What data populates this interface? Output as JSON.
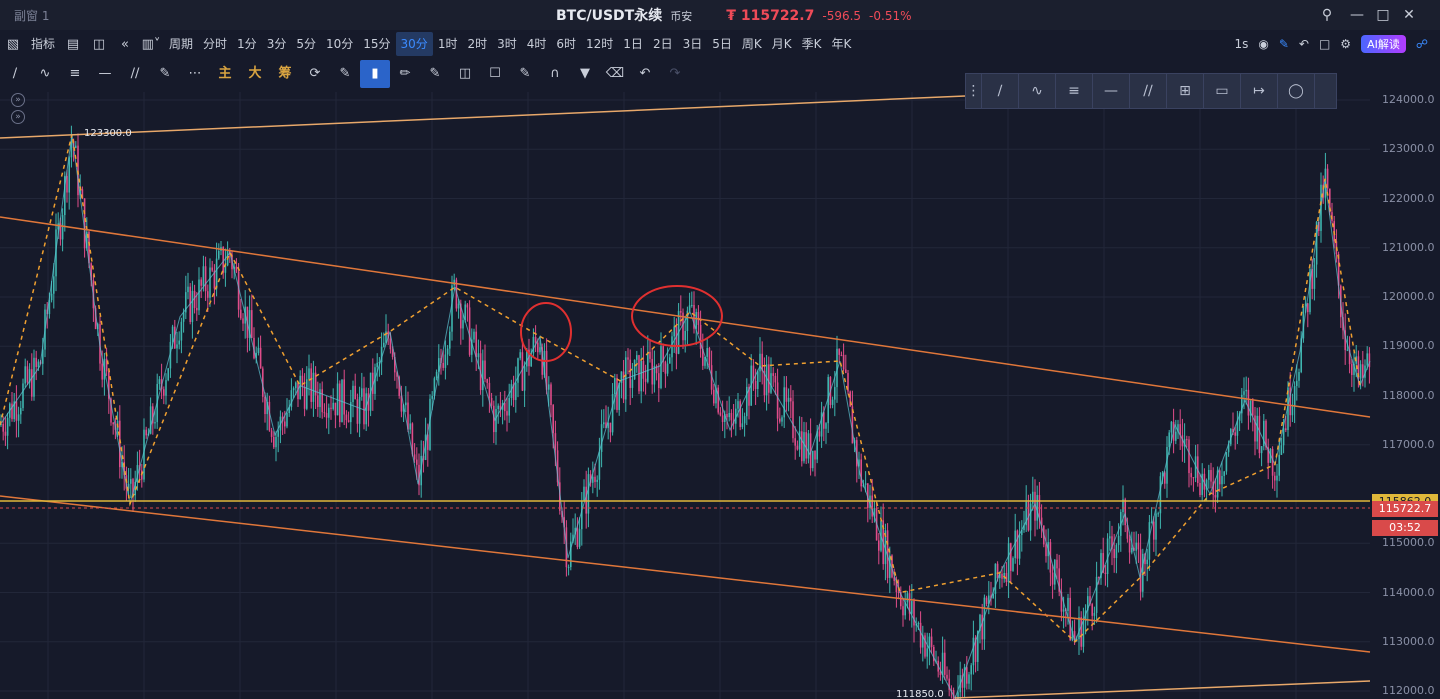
{
  "window": {
    "name": "副窗 1"
  },
  "header": {
    "symbol": "BTC/USDT永续",
    "exchange": "币安",
    "price": "₮ 115722.7",
    "change": "-596.5",
    "change_pct": "-0.51%"
  },
  "toolbar": {
    "indicator_label": "指标",
    "period_label": "周期",
    "intervals": [
      "分时",
      "1分",
      "3分",
      "5分",
      "10分",
      "15分",
      "30分",
      "1时",
      "2时",
      "3时",
      "4时",
      "6时",
      "12时",
      "1日",
      "2日",
      "3日",
      "5日",
      "周K",
      "月K",
      "季K",
      "年K"
    ],
    "active_interval": "30分",
    "refresh": "1s",
    "ai_label": "AI解读"
  },
  "drawbar": {
    "main": "主",
    "big": "大",
    "chip": "筹"
  },
  "axis": {
    "ticks": [
      "124000.0",
      "123000.0",
      "122000.0",
      "121000.0",
      "120000.0",
      "119000.0",
      "118000.0",
      "117000.0",
      "115000.0",
      "114000.0",
      "113000.0",
      "112000.0"
    ],
    "yellow_level": "115862.0",
    "current_price": "115722.7",
    "countdown": "03:52"
  },
  "annotations": {
    "high": "123300.0",
    "low": "111850.0"
  },
  "colors": {
    "up": "#ef4b58",
    "line_orange": "#e0773a",
    "line_yellow": "#e0b83a",
    "bg": "#161a2a"
  }
}
